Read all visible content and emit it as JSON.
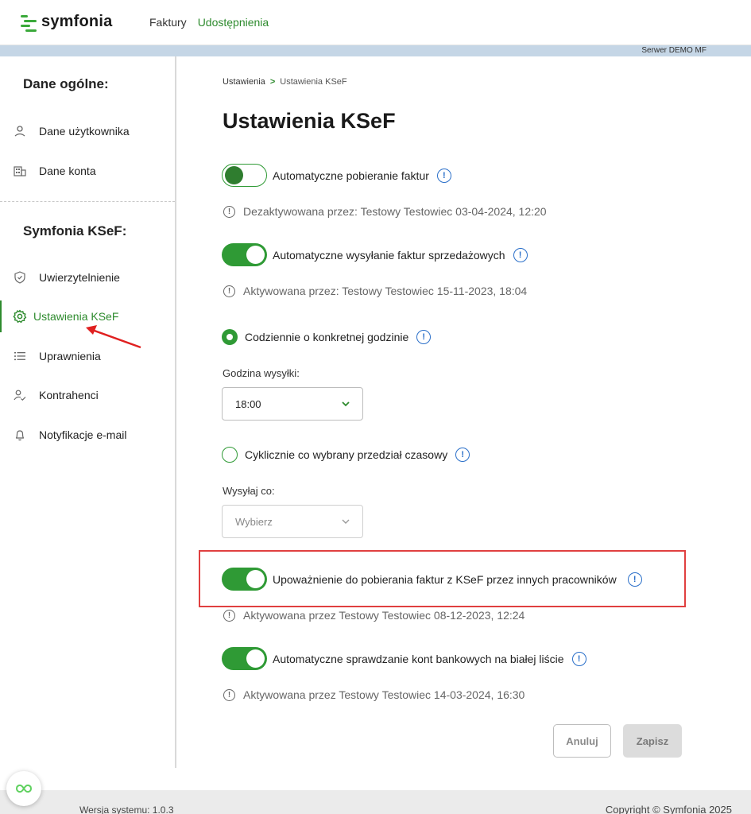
{
  "app": {
    "logo_text": "symfonia",
    "nav": [
      {
        "label": "Faktury"
      },
      {
        "label": "Udostępnienia"
      }
    ],
    "server_label": "Serwer DEMO MF",
    "accent": "#2f9a35",
    "info_color": "#2a6fc9"
  },
  "sidebar": {
    "section1": "Dane ogólne:",
    "items1": [
      {
        "label": "Dane użytkownika",
        "icon": "user-icon"
      },
      {
        "label": "Dane konta",
        "icon": "building-icon"
      }
    ],
    "section2": "Symfonia KSeF:",
    "items2": [
      {
        "label": "Uwierzytelnienie",
        "icon": "shield-icon"
      },
      {
        "label": "Ustawienia KSeF",
        "icon": "gear-icon",
        "active": true
      },
      {
        "label": "Uprawnienia",
        "icon": "list-icon"
      },
      {
        "label": "Kontrahenci",
        "icon": "user-check-icon"
      },
      {
        "label": "Notyfikacje e-mail",
        "icon": "bell-icon"
      }
    ]
  },
  "breadcrumb": {
    "root": "Ustawienia",
    "separator": ">",
    "current": "Ustawienia KSeF"
  },
  "page": {
    "title": "Ustawienia KSeF",
    "auto_download": {
      "label": "Automatyczne pobieranie faktur",
      "enabled": false,
      "note": "Dezaktywowana przez: Testowy Testowiec 03-04-2024, 12:20"
    },
    "auto_send": {
      "label": "Automatyczne wysyłanie faktur sprzedażowych",
      "enabled": true,
      "note": "Aktywowana przez: Testowy Testowiec 15-11-2023, 18:04"
    },
    "daily_option": {
      "label": "Codziennie o konkretnej godzinie",
      "selected": true
    },
    "send_hour": {
      "label": "Godzina wysyłki:",
      "value": "18:00"
    },
    "cyclic_option": {
      "label": "Cyklicznie co wybrany przedział czasowy",
      "selected": false
    },
    "send_every": {
      "label": "Wysyłaj co:",
      "placeholder": "Wybierz"
    },
    "authorization": {
      "label": "Upoważnienie do pobierania faktur z KSeF przez innych pracowników",
      "enabled": true,
      "note": "Aktywowana przez Testowy Testowiec 08-12-2023, 12:24"
    },
    "bank_check": {
      "label": "Automatyczne sprawdzanie kont bankowych na białej liście",
      "enabled": true,
      "note": "Aktywowana przez Testowy Testowiec 14-03-2024, 16:30"
    },
    "cancel_label": "Anuluj",
    "save_label": "Zapisz"
  },
  "footer": {
    "version": "Wersja systemu: 1.0.3",
    "copyright": "Copyright © Symfonia 2025"
  }
}
